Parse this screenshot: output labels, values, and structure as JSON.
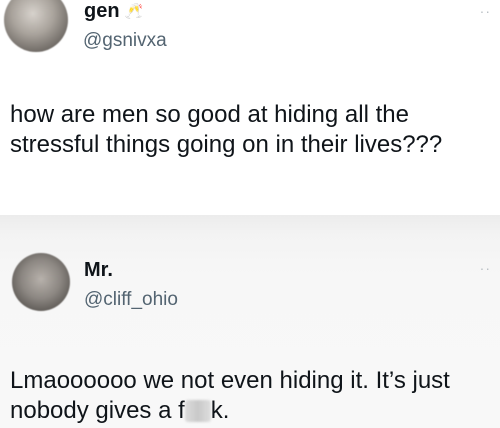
{
  "tweets": [
    {
      "name": "gen",
      "name_emoji": "🥂",
      "handle": "@gsnivxa",
      "more_icon": "more-options-icon",
      "text_lines": [
        "how are men so good at hiding all the",
        "stressful things going on in their lives???"
      ]
    },
    {
      "name": "Mr.",
      "handle": "@cliff_ohio",
      "more_icon": "more-options-icon",
      "text_lines": [
        "Lmaoooooo we not even hiding it. It’s just",
        "nobody gives a f"
      ],
      "text_line_2_after_censor": "k."
    }
  ]
}
